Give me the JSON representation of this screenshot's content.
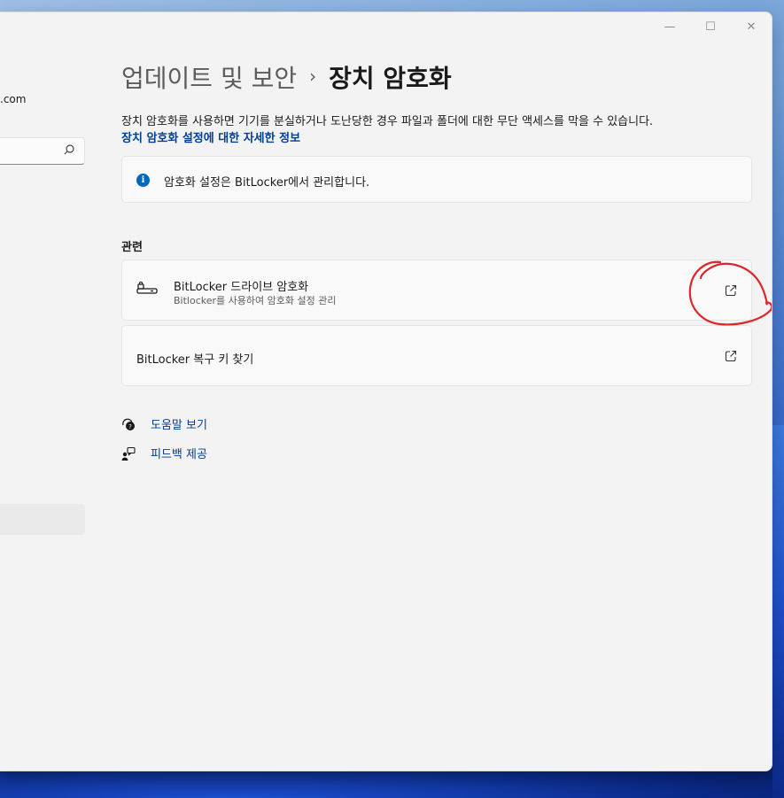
{
  "window": {
    "controls": {
      "minimize": "—",
      "maximize": "☐",
      "close": "✕"
    }
  },
  "sidebar": {
    "account_email": ".com",
    "search": {
      "placeholder": ""
    }
  },
  "header": {
    "breadcrumb_parent": "업데이트 및 보안",
    "breadcrumb_separator": "›",
    "page_title": "장치 암호화"
  },
  "main": {
    "description": "장치 암호화를 사용하면 기기를 분실하거나 도난당한 경우 파일과 폴더에 대한 무단 액세스를 막을 수 있습니다.",
    "learn_more_link": "장치 암호화 설정에 대한 자세한 정보",
    "info_message": "암호화 설정은 BitLocker에서 관리합니다.",
    "info_icon": "i",
    "related_title": "관련",
    "related_items": [
      {
        "title": "BitLocker 드라이브 암호화",
        "subtitle": "Bitlocker를 사용하여 암호화 설정 관리",
        "icon": "drive-lock-icon",
        "action_icon": "open-external-icon"
      },
      {
        "title": "BitLocker 복구 키 찾기",
        "action_icon": "open-external-icon"
      }
    ],
    "help_links": [
      {
        "label": "도움말 보기",
        "icon": "help-icon"
      },
      {
        "label": "피드백 제공",
        "icon": "feedback-icon"
      }
    ]
  },
  "colors": {
    "link": "#003e92",
    "accent": "#0067c0",
    "annotation": "#e0262a",
    "window_bg": "#f3f3f3",
    "card_bg": "#f9f9f9"
  }
}
